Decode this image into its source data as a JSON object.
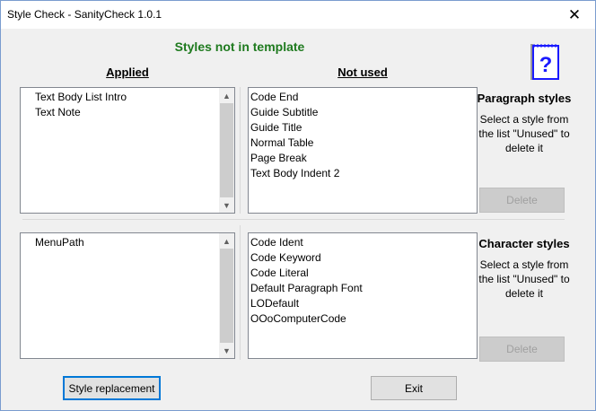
{
  "window": {
    "title": "Style Check - SanityCheck 1.0.1",
    "close_glyph": "✕"
  },
  "heading": "Styles not in template",
  "help_glyph": "?",
  "columns": {
    "applied": "Applied",
    "not_used": "Not used"
  },
  "paragraph": {
    "applied": [
      "Text Body List Intro",
      "Text Note"
    ],
    "not_used": [
      "Code End",
      "Guide Subtitle",
      "Guide Title",
      "Normal Table",
      "Page Break",
      "Text Body Indent 2"
    ],
    "side_title": "Paragraph styles",
    "side_desc": "Select a style from the list \"Unused\" to delete it",
    "delete_label": "Delete"
  },
  "character": {
    "applied": [
      "MenuPath"
    ],
    "not_used": [
      "Code Ident",
      "Code Keyword",
      "Code Literal",
      "Default Paragraph Font",
      "LODefault",
      "OOoComputerCode"
    ],
    "side_title": "Character styles",
    "side_desc": "Select a style from the list \"Unused\" to delete it",
    "delete_label": "Delete"
  },
  "buttons": {
    "style_replacement": "Style replacement",
    "exit": "Exit"
  },
  "scroll": {
    "up": "▲",
    "down": "▼"
  },
  "colors": {
    "heading": "#1e7a1e",
    "help_icon": "#1a1aff",
    "focus": "#0078d7"
  }
}
